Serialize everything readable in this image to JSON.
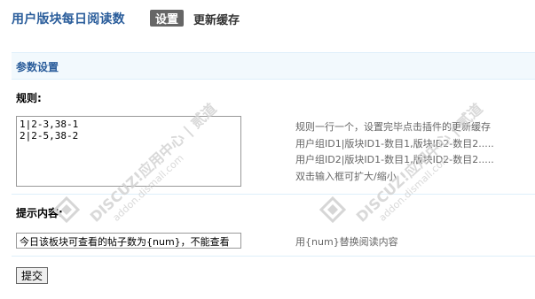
{
  "header": {
    "title": "用户版块每日阅读数",
    "active_tab": "设置",
    "other_tab": "更新缓存"
  },
  "section": {
    "title": "参数设置"
  },
  "rules": {
    "label": "规则:",
    "lines": [
      "1|2-3,38-1",
      "2|2-5,38-2"
    ],
    "help": [
      "规则一行一个，设置完毕点击插件的更新缓存",
      "用户组ID1|版块ID1-数目1,版块ID2-数目2.....",
      "用户组ID2|版块ID1-数目1,版块ID2-数目2.....",
      "双击输入框可扩大/缩小"
    ]
  },
  "tip": {
    "label": "提示内容:",
    "value": "今日该板块可查看的帖子数为{num}，不能查看",
    "help": "用{num}替换阅读内容"
  },
  "submit_label": "提交",
  "watermark": {
    "brand": "DISCUZ!应用中心 | 贰道",
    "url": "addon.dismall.com"
  }
}
